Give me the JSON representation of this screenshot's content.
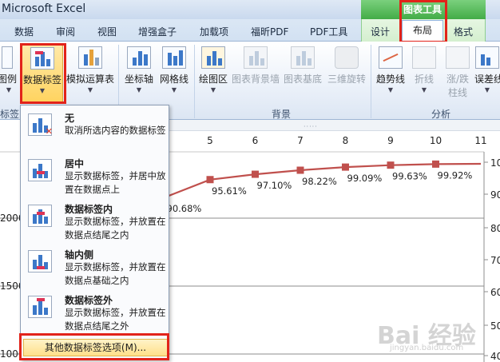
{
  "window": {
    "title": "Microsoft Excel"
  },
  "context_tabs": {
    "group_title": "图表工具"
  },
  "tabs": [
    {
      "label": "数据"
    },
    {
      "label": "审阅"
    },
    {
      "label": "视图"
    },
    {
      "label": "增强盒子"
    },
    {
      "label": "加载项"
    },
    {
      "label": "福昕PDF"
    },
    {
      "label": "PDF工具"
    },
    {
      "label": "设计"
    },
    {
      "label": "布局",
      "active": true
    },
    {
      "label": "格式"
    }
  ],
  "ribbon": {
    "buttons": [
      {
        "label": "图例",
        "dropdown": true
      },
      {
        "label": "数据标签",
        "dropdown": true,
        "pressed": true
      },
      {
        "label": "模拟运算表",
        "dropdown": true
      },
      {
        "label": "坐标轴",
        "dropdown": true
      },
      {
        "label": "网格线",
        "dropdown": true
      },
      {
        "label": "绘图区",
        "dropdown": true
      },
      {
        "label": "图表背景墙",
        "disabled": true
      },
      {
        "label": "图表基底",
        "disabled": true
      },
      {
        "label": "三维旋转",
        "disabled": true
      },
      {
        "label": "趋势线",
        "dropdown": true
      },
      {
        "label": "折线",
        "disabled": true
      },
      {
        "label": "涨/跌",
        "label2": "柱线",
        "disabled": true
      },
      {
        "label": "误差线",
        "dropdown": true
      }
    ],
    "groups": {
      "labels": "标签",
      "background": "背景",
      "analysis": "分析"
    }
  },
  "dropdown_menu": {
    "items": [
      {
        "title": "无",
        "desc": "取消所选内容的数据标签",
        "icon": "no-data-labels-icon"
      },
      {
        "title": "居中",
        "desc": "显示数据标签，并居中放置在数据点上",
        "icon": "data-labels-center-icon"
      },
      {
        "title": "数据标签内",
        "desc": "显示数据标签，并放置在数据点结尾之内",
        "icon": "data-labels-inside-end-icon"
      },
      {
        "title": "轴内侧",
        "desc": "显示数据标签，并放置在数据点基础之内",
        "icon": "data-labels-inside-base-icon"
      },
      {
        "title": "数据标签外",
        "desc": "显示数据标签，并放置在数据点结尾之外",
        "icon": "data-labels-outside-end-icon"
      }
    ],
    "more_options": "其他数据标签选项(M)..."
  },
  "chart_data": {
    "type": "line",
    "x_ticks": [
      "5",
      "6",
      "7",
      "8",
      "9",
      "10",
      "11"
    ],
    "left_ticks": [
      "2000",
      "1500",
      "1000"
    ],
    "right_ticks": [
      "10",
      "90",
      "80",
      "70",
      "60",
      "50",
      "40"
    ],
    "series": [
      {
        "x": [
          4,
          5,
          6,
          7,
          8,
          9,
          10,
          11
        ],
        "y": [
          90.68,
          95.61,
          97.1,
          98.22,
          99.09,
          99.63,
          99.92,
          100.0
        ],
        "labels": [
          "90.68%",
          "95.61%",
          "97.10%",
          "98.22%",
          "99.09%",
          "99.63%",
          "99.92%",
          ""
        ]
      }
    ],
    "colors": {
      "line": "#c0504d",
      "marker": "#c0504d"
    }
  },
  "watermark": {
    "text": "Bai 经验",
    "sub": "jingyan.baidu.com"
  }
}
